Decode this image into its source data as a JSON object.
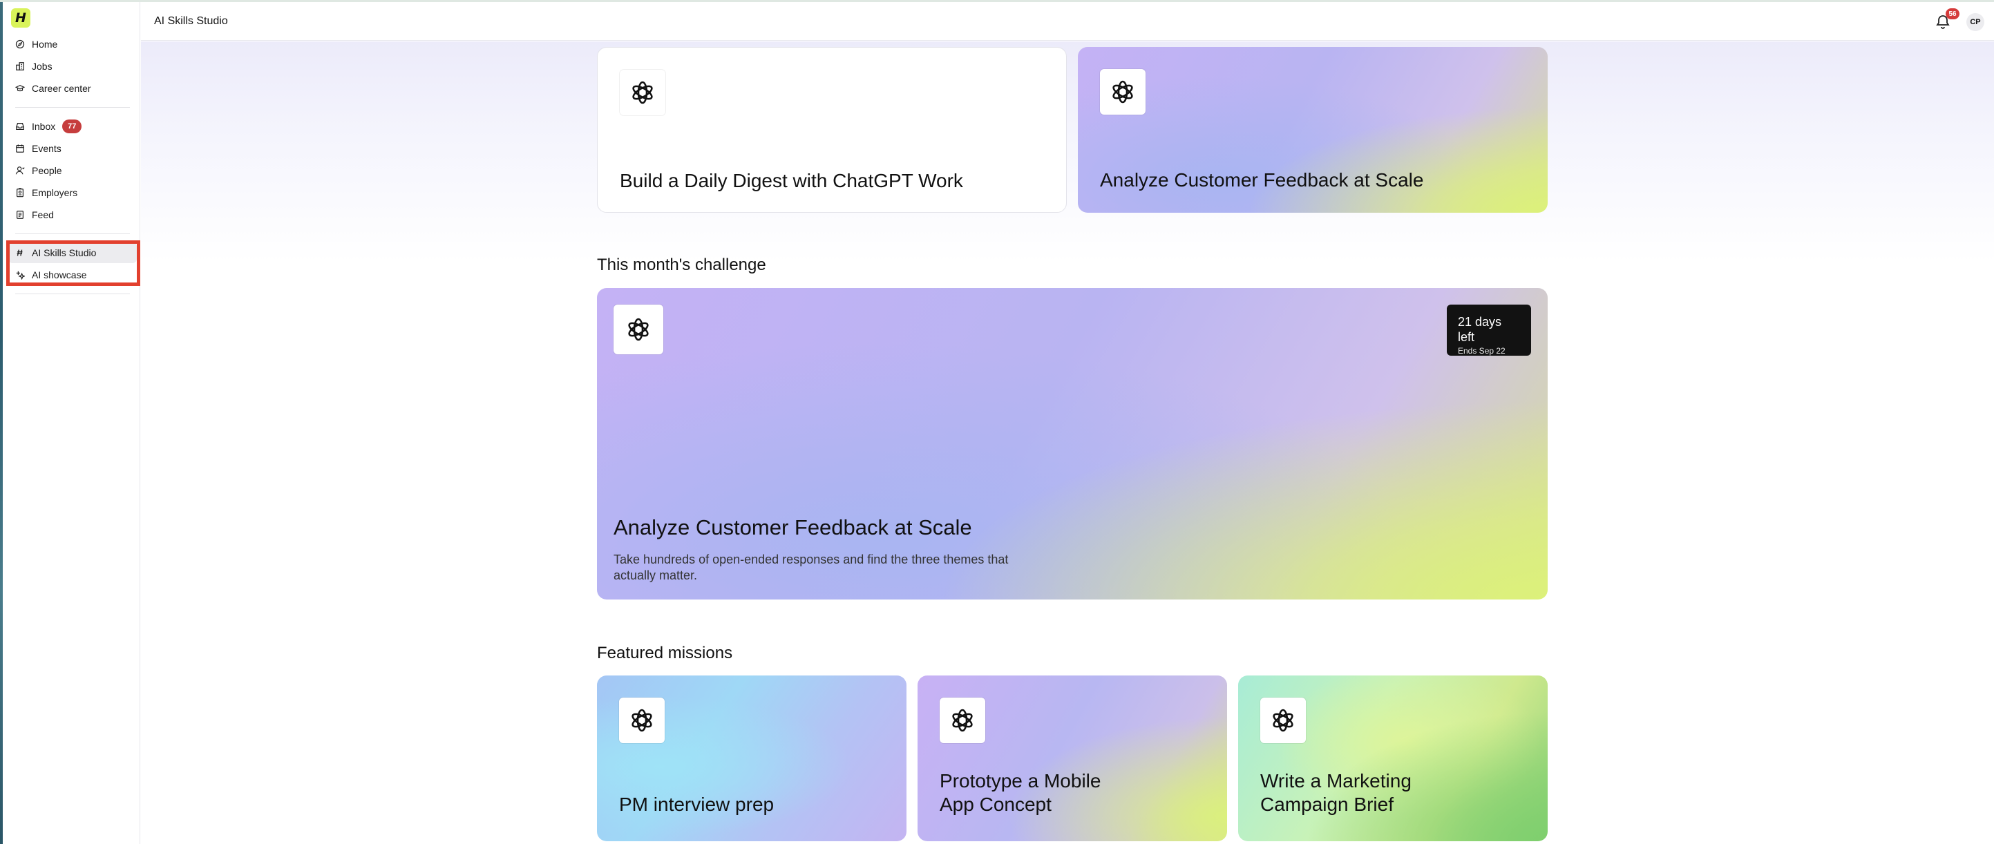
{
  "app": {
    "logo_text": "H"
  },
  "sidebar": {
    "group1": [
      {
        "label": "Home",
        "icon": "compass-icon"
      },
      {
        "label": "Jobs",
        "icon": "building-icon"
      },
      {
        "label": "Career center",
        "icon": "graduation-cap-icon"
      }
    ],
    "group2": [
      {
        "label": "Inbox",
        "icon": "inbox-icon",
        "badge": "77"
      },
      {
        "label": "Events",
        "icon": "calendar-icon"
      },
      {
        "label": "People",
        "icon": "person-icon"
      },
      {
        "label": "Employers",
        "icon": "id-badge-icon"
      },
      {
        "label": "Feed",
        "icon": "document-icon"
      }
    ],
    "group3": [
      {
        "label": "AI Skills Studio",
        "icon": "studio-logo-icon",
        "active": true
      },
      {
        "label": "AI showcase",
        "icon": "sparkle-icon"
      }
    ]
  },
  "header": {
    "title": "AI Skills Studio",
    "notification_count": "56",
    "avatar_initials": "CP"
  },
  "top_cards": [
    {
      "title": "Build a Daily Digest with ChatGPT Work",
      "icon": "openai-logo-icon"
    },
    {
      "title": "Analyze Customer Feedback at Scale",
      "icon": "openai-logo-icon"
    }
  ],
  "challenge": {
    "section_title": "This month's challenge",
    "title": "Analyze Customer Feedback at Scale",
    "description": "Take hundreds of open-ended responses and find the three themes that actually matter.",
    "days_left": "21 days left",
    "ends": "Ends Sep 22"
  },
  "featured": {
    "section_title": "Featured missions",
    "cards": [
      {
        "title": "PM interview prep"
      },
      {
        "title": "Prototype a Mobile App Concept"
      },
      {
        "title": "Write a Marketing Campaign Brief"
      }
    ]
  },
  "colors": {
    "accent_lime": "#d9f35a",
    "badge_red": "#c63d3d",
    "highlight_red": "#e2402e",
    "gradient_purple": "#c4b2f5",
    "gradient_blue": "#a9b5f2",
    "gradient_lime": "#dcf17a"
  }
}
